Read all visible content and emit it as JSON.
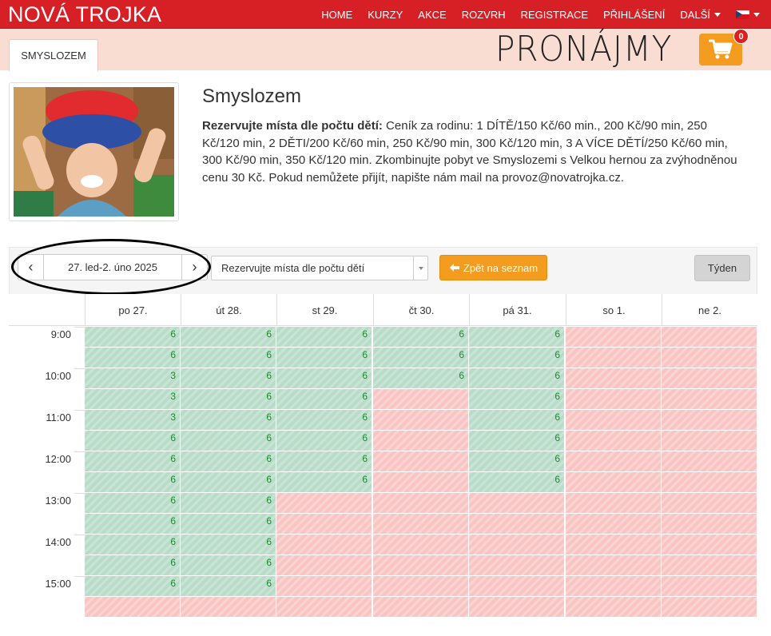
{
  "brand": "NOVÁ TROJKA",
  "nav": [
    "HOME",
    "KURZY",
    "AKCE",
    "ROZVRH",
    "REGISTRACE",
    "PŘIHLÁŠENÍ",
    "DALŠÍ"
  ],
  "tab": "SMYSLOZEM",
  "page_heading": "PRONÁJMY",
  "cart_count": "0",
  "product": {
    "title": "Smyslozem",
    "desc_bold": "Rezervujte místa dle počtu dětí:",
    "desc_text": " Ceník za rodinu: 1 DÍTĚ/150 Kč/60 min., 200 Kč/90 min, 250 Kč/120 min, 2 DĚTI/200 Kč/60 min, 250 Kč/90 min, 300 Kč/120 min, 3 A VÍCE DĚTÍ/250 Kč/60 min, 300 Kč/90 min, 350 Kč/120 min. Zkombinujte pobyt ve Smyslozemi s Velkou hernou za zvýhodněnou cenu 30 Kč. Pokud nemůžete přijít, napište nám mail na provoz@novatrojka.cz."
  },
  "calendar": {
    "prev": "‹",
    "next": "›",
    "date_range": "27. led-2. úno 2025",
    "select_value": "Rezervujte místa dle počtu dětí",
    "back_label": "Zpět na seznam",
    "week_label": "Týden",
    "days": [
      "po 27.",
      "út 28.",
      "st 29.",
      "čt 30.",
      "pá 31.",
      "so 1.",
      "ne 2."
    ],
    "times": [
      "9:00",
      "10:00",
      "11:00",
      "12:00",
      "13:00",
      "14:00",
      "15:00"
    ],
    "slots": [
      [
        "6",
        "6",
        "6",
        "6",
        "6",
        "",
        ""
      ],
      [
        "6",
        "6",
        "6",
        "6",
        "6",
        "",
        ""
      ],
      [
        "3",
        "6",
        "6",
        "6",
        "6",
        "",
        ""
      ],
      [
        "3",
        "6",
        "6",
        "",
        "6",
        "",
        ""
      ],
      [
        "3",
        "6",
        "6",
        "",
        "6",
        "",
        ""
      ],
      [
        "6",
        "6",
        "6",
        "",
        "6",
        "",
        ""
      ],
      [
        "6",
        "6",
        "6",
        "",
        "6",
        "",
        ""
      ],
      [
        "6",
        "6",
        "6",
        "",
        "6",
        "",
        ""
      ],
      [
        "6",
        "6",
        "",
        "",
        "",
        "",
        ""
      ],
      [
        "6",
        "6",
        "",
        "",
        "",
        "",
        ""
      ],
      [
        "6",
        "6",
        "",
        "",
        "",
        "",
        ""
      ],
      [
        "6",
        "6",
        "",
        "",
        "",
        "",
        ""
      ],
      [
        "6",
        "6",
        "",
        "",
        "",
        "",
        ""
      ],
      [
        "",
        "",
        "",
        "",
        "",
        "",
        ""
      ]
    ]
  },
  "colors": {
    "brand_red": "#d71f26",
    "accent_orange": "#f39c1f",
    "free_green": "#b9dcc9",
    "busy_red": "#f9c4c2"
  }
}
